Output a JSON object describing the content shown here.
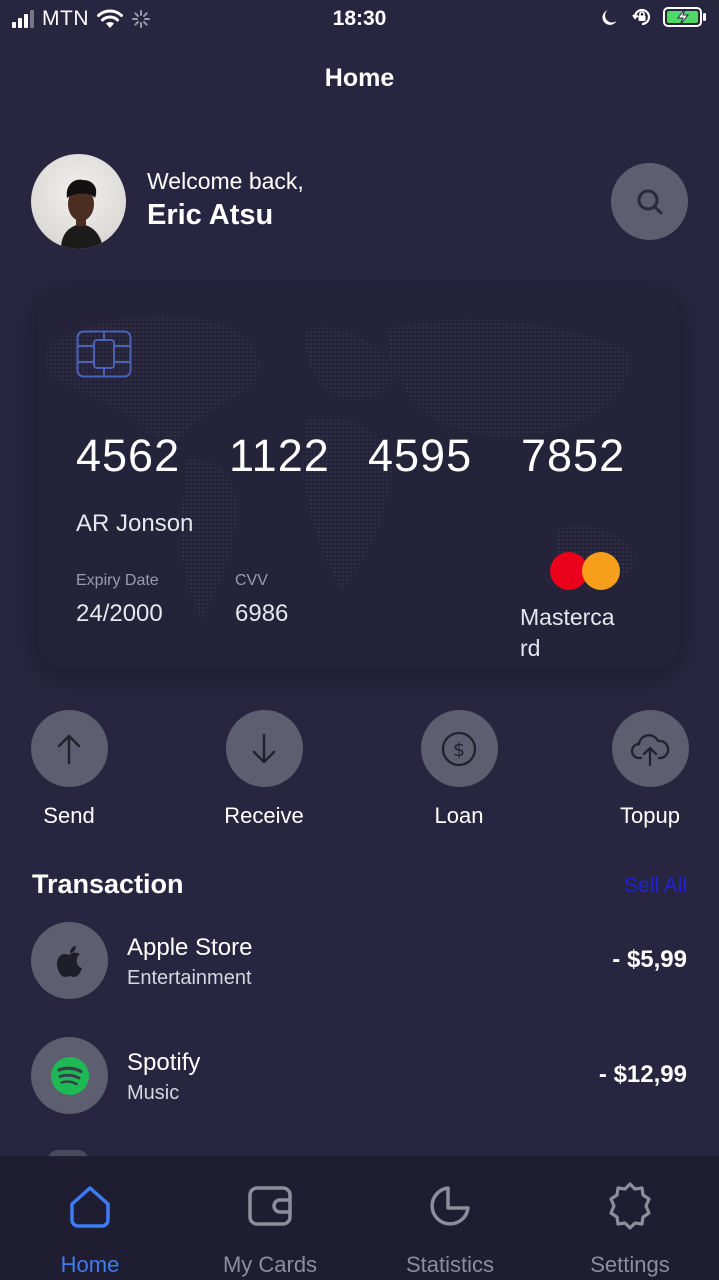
{
  "status_bar": {
    "carrier": "MTN",
    "time": "18:30"
  },
  "nav": {
    "title": "Home"
  },
  "profile": {
    "welcome": "Welcome back,",
    "name": "Eric Atsu"
  },
  "card": {
    "number_groups": [
      "4562",
      "1122",
      "4595",
      "7852"
    ],
    "holder": "AR Jonson",
    "expiry_label": "Expiry Date",
    "expiry_value": "24/2000",
    "cvv_label": "CVV",
    "cvv_value": "6986",
    "brand": "Mastercard"
  },
  "actions": [
    {
      "label": "Send",
      "icon": "arrow-up-icon"
    },
    {
      "label": "Receive",
      "icon": "arrow-down-icon"
    },
    {
      "label": "Loan",
      "icon": "dollar-icon"
    },
    {
      "label": "Topup",
      "icon": "cloud-upload-icon"
    }
  ],
  "transactions": {
    "title": "Transaction",
    "see_all": "Sell All",
    "items": [
      {
        "name": "Apple Store",
        "category": "Entertainment",
        "amount": "- $5,99",
        "icon": "apple-icon"
      },
      {
        "name": "Spotify",
        "category": "Music",
        "amount": "- $12,99",
        "icon": "spotify-icon"
      }
    ]
  },
  "bottom_nav": [
    {
      "label": "Home",
      "icon": "home-icon",
      "active": true
    },
    {
      "label": "My Cards",
      "icon": "wallet-icon",
      "active": false
    },
    {
      "label": "Statistics",
      "icon": "pie-chart-icon",
      "active": false
    },
    {
      "label": "Settings",
      "icon": "settings-icon",
      "active": false
    }
  ],
  "colors": {
    "background": "#27253f",
    "card": "#242339",
    "button": "#5d5e70",
    "accent": "#3e7cf7",
    "link": "#1f24d6",
    "mastercard_red": "#eb001b",
    "mastercard_orange": "#f79e1b"
  }
}
